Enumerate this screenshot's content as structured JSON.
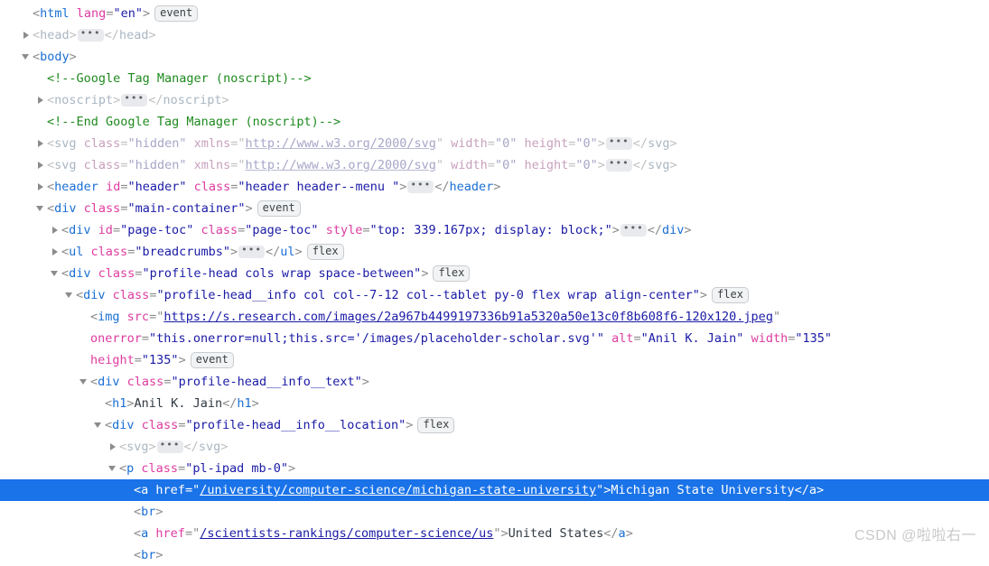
{
  "panel": {
    "name": "devtools-elements-panel",
    "selected_line_index": 19,
    "accent_selection_color": "#1a73e8",
    "tag_color": "#1a6fd4",
    "attr_name_color": "#de3ca0",
    "attr_value_color": "#1a1aa6",
    "comment_color": "#1f8a1f"
  },
  "badges": {
    "event": "event",
    "flex": "flex",
    "ellipsis": "•••"
  },
  "lines": [
    {
      "indent": 1,
      "twisty": "none",
      "dim": false,
      "badge": "event",
      "tokens": [
        {
          "t": "punct",
          "v": "<"
        },
        {
          "t": "tag",
          "v": "html"
        },
        {
          "t": "sp",
          "v": " "
        },
        {
          "t": "attr-name",
          "v": "lang"
        },
        {
          "t": "punct",
          "v": "="
        },
        {
          "t": "attr-val",
          "v": "\"en\""
        },
        {
          "t": "punct",
          "v": ">"
        }
      ]
    },
    {
      "indent": 1,
      "twisty": "closed",
      "dim": true,
      "badge": null,
      "tokens": [
        {
          "t": "punct",
          "v": "<"
        },
        {
          "t": "tag",
          "v": "head"
        },
        {
          "t": "punct",
          "v": ">"
        },
        {
          "t": "ellipsis",
          "v": "•••"
        },
        {
          "t": "punct",
          "v": "</"
        },
        {
          "t": "tag",
          "v": "head"
        },
        {
          "t": "punct",
          "v": ">"
        }
      ]
    },
    {
      "indent": 1,
      "twisty": "open",
      "dim": false,
      "badge": null,
      "tokens": [
        {
          "t": "punct",
          "v": "<"
        },
        {
          "t": "tag",
          "v": "body"
        },
        {
          "t": "punct",
          "v": ">"
        }
      ]
    },
    {
      "indent": 2,
      "twisty": "none",
      "dim": false,
      "badge": null,
      "tokens": [
        {
          "t": "comment",
          "v": "<!--Google Tag Manager (noscript)-->"
        }
      ]
    },
    {
      "indent": 2,
      "twisty": "closed",
      "dim": true,
      "badge": null,
      "tokens": [
        {
          "t": "punct",
          "v": "<"
        },
        {
          "t": "tag",
          "v": "noscript"
        },
        {
          "t": "punct",
          "v": ">"
        },
        {
          "t": "ellipsis",
          "v": "•••"
        },
        {
          "t": "punct",
          "v": "</"
        },
        {
          "t": "tag",
          "v": "noscript"
        },
        {
          "t": "punct",
          "v": ">"
        }
      ]
    },
    {
      "indent": 2,
      "twisty": "none",
      "dim": false,
      "badge": null,
      "tokens": [
        {
          "t": "comment",
          "v": "<!--End Google Tag Manager (noscript)-->"
        }
      ]
    },
    {
      "indent": 2,
      "twisty": "closed",
      "dim": true,
      "badge": null,
      "tokens": [
        {
          "t": "punct",
          "v": "<"
        },
        {
          "t": "tag",
          "v": "svg"
        },
        {
          "t": "sp",
          "v": " "
        },
        {
          "t": "attr-name",
          "v": "class"
        },
        {
          "t": "punct",
          "v": "="
        },
        {
          "t": "attr-val",
          "v": "\"hidden\""
        },
        {
          "t": "sp",
          "v": " "
        },
        {
          "t": "attr-name",
          "v": "xmlns"
        },
        {
          "t": "punct",
          "v": "="
        },
        {
          "t": "punct",
          "v": "\""
        },
        {
          "t": "link",
          "v": "http://www.w3.org/2000/svg"
        },
        {
          "t": "punct",
          "v": "\""
        },
        {
          "t": "sp",
          "v": " "
        },
        {
          "t": "attr-name",
          "v": "width"
        },
        {
          "t": "punct",
          "v": "="
        },
        {
          "t": "attr-val",
          "v": "\"0\""
        },
        {
          "t": "sp",
          "v": " "
        },
        {
          "t": "attr-name",
          "v": "height"
        },
        {
          "t": "punct",
          "v": "="
        },
        {
          "t": "attr-val",
          "v": "\"0\""
        },
        {
          "t": "punct",
          "v": ">"
        },
        {
          "t": "ellipsis",
          "v": "•••"
        },
        {
          "t": "punct",
          "v": "</"
        },
        {
          "t": "tag",
          "v": "svg"
        },
        {
          "t": "punct",
          "v": ">"
        }
      ]
    },
    {
      "indent": 2,
      "twisty": "closed",
      "dim": true,
      "badge": null,
      "tokens": [
        {
          "t": "punct",
          "v": "<"
        },
        {
          "t": "tag",
          "v": "svg"
        },
        {
          "t": "sp",
          "v": " "
        },
        {
          "t": "attr-name",
          "v": "class"
        },
        {
          "t": "punct",
          "v": "="
        },
        {
          "t": "attr-val",
          "v": "\"hidden\""
        },
        {
          "t": "sp",
          "v": " "
        },
        {
          "t": "attr-name",
          "v": "xmlns"
        },
        {
          "t": "punct",
          "v": "="
        },
        {
          "t": "punct",
          "v": "\""
        },
        {
          "t": "link",
          "v": "http://www.w3.org/2000/svg"
        },
        {
          "t": "punct",
          "v": "\""
        },
        {
          "t": "sp",
          "v": " "
        },
        {
          "t": "attr-name",
          "v": "width"
        },
        {
          "t": "punct",
          "v": "="
        },
        {
          "t": "attr-val",
          "v": "\"0\""
        },
        {
          "t": "sp",
          "v": " "
        },
        {
          "t": "attr-name",
          "v": "height"
        },
        {
          "t": "punct",
          "v": "="
        },
        {
          "t": "attr-val",
          "v": "\"0\""
        },
        {
          "t": "punct",
          "v": ">"
        },
        {
          "t": "ellipsis",
          "v": "•••"
        },
        {
          "t": "punct",
          "v": "</"
        },
        {
          "t": "tag",
          "v": "svg"
        },
        {
          "t": "punct",
          "v": ">"
        }
      ]
    },
    {
      "indent": 2,
      "twisty": "closed",
      "dim": false,
      "badge": null,
      "tokens": [
        {
          "t": "punct",
          "v": "<"
        },
        {
          "t": "tag",
          "v": "header"
        },
        {
          "t": "sp",
          "v": " "
        },
        {
          "t": "attr-name",
          "v": "id"
        },
        {
          "t": "punct",
          "v": "="
        },
        {
          "t": "attr-val",
          "v": "\"header\""
        },
        {
          "t": "sp",
          "v": " "
        },
        {
          "t": "attr-name",
          "v": "class"
        },
        {
          "t": "punct",
          "v": "="
        },
        {
          "t": "attr-val",
          "v": "\"header header--menu \""
        },
        {
          "t": "punct",
          "v": ">"
        },
        {
          "t": "ellipsis",
          "v": "•••"
        },
        {
          "t": "punct",
          "v": "</"
        },
        {
          "t": "tag",
          "v": "header"
        },
        {
          "t": "punct",
          "v": ">"
        }
      ]
    },
    {
      "indent": 2,
      "twisty": "open",
      "dim": false,
      "badge": "event",
      "tokens": [
        {
          "t": "punct",
          "v": "<"
        },
        {
          "t": "tag",
          "v": "div"
        },
        {
          "t": "sp",
          "v": " "
        },
        {
          "t": "attr-name",
          "v": "class"
        },
        {
          "t": "punct",
          "v": "="
        },
        {
          "t": "attr-val",
          "v": "\"main-container\""
        },
        {
          "t": "punct",
          "v": ">"
        }
      ]
    },
    {
      "indent": 3,
      "twisty": "closed",
      "dim": false,
      "badge": null,
      "tokens": [
        {
          "t": "punct",
          "v": "<"
        },
        {
          "t": "tag",
          "v": "div"
        },
        {
          "t": "sp",
          "v": " "
        },
        {
          "t": "attr-name",
          "v": "id"
        },
        {
          "t": "punct",
          "v": "="
        },
        {
          "t": "attr-val",
          "v": "\"page-toc\""
        },
        {
          "t": "sp",
          "v": " "
        },
        {
          "t": "attr-name",
          "v": "class"
        },
        {
          "t": "punct",
          "v": "="
        },
        {
          "t": "attr-val",
          "v": "\"page-toc\""
        },
        {
          "t": "sp",
          "v": " "
        },
        {
          "t": "attr-name",
          "v": "style"
        },
        {
          "t": "punct",
          "v": "="
        },
        {
          "t": "attr-val",
          "v": "\"top: 339.167px; display: block;\""
        },
        {
          "t": "punct",
          "v": ">"
        },
        {
          "t": "ellipsis",
          "v": "•••"
        },
        {
          "t": "punct",
          "v": "</"
        },
        {
          "t": "tag",
          "v": "div"
        },
        {
          "t": "punct",
          "v": ">"
        }
      ]
    },
    {
      "indent": 3,
      "twisty": "closed",
      "dim": false,
      "badge": "flex",
      "tokens": [
        {
          "t": "punct",
          "v": "<"
        },
        {
          "t": "tag",
          "v": "ul"
        },
        {
          "t": "sp",
          "v": " "
        },
        {
          "t": "attr-name",
          "v": "class"
        },
        {
          "t": "punct",
          "v": "="
        },
        {
          "t": "attr-val",
          "v": "\"breadcrumbs\""
        },
        {
          "t": "punct",
          "v": ">"
        },
        {
          "t": "ellipsis",
          "v": "•••"
        },
        {
          "t": "punct",
          "v": "</"
        },
        {
          "t": "tag",
          "v": "ul"
        },
        {
          "t": "punct",
          "v": ">"
        }
      ]
    },
    {
      "indent": 3,
      "twisty": "open",
      "dim": false,
      "badge": "flex",
      "tokens": [
        {
          "t": "punct",
          "v": "<"
        },
        {
          "t": "tag",
          "v": "div"
        },
        {
          "t": "sp",
          "v": " "
        },
        {
          "t": "attr-name",
          "v": "class"
        },
        {
          "t": "punct",
          "v": "="
        },
        {
          "t": "attr-val",
          "v": "\"profile-head cols wrap space-between\""
        },
        {
          "t": "punct",
          "v": ">"
        }
      ]
    },
    {
      "indent": 4,
      "twisty": "open",
      "dim": false,
      "badge": "flex",
      "tokens": [
        {
          "t": "punct",
          "v": "<"
        },
        {
          "t": "tag",
          "v": "div"
        },
        {
          "t": "sp",
          "v": " "
        },
        {
          "t": "attr-name",
          "v": "class"
        },
        {
          "t": "punct",
          "v": "="
        },
        {
          "t": "attr-val",
          "v": "\"profile-head__info col col--7-12 col--tablet py-0 flex wrap align-center\""
        },
        {
          "t": "punct",
          "v": ">"
        }
      ]
    },
    {
      "indent": 5,
      "twisty": "none",
      "dim": false,
      "badge": null,
      "tokens": [
        {
          "t": "punct",
          "v": "<"
        },
        {
          "t": "tag",
          "v": "img"
        },
        {
          "t": "sp",
          "v": " "
        },
        {
          "t": "attr-name",
          "v": "src"
        },
        {
          "t": "punct",
          "v": "="
        },
        {
          "t": "punct",
          "v": "\""
        },
        {
          "t": "link",
          "v": "https://s.research.com/images/2a967b4499197336b91a5320a50e13c0f8b608f6-120x120.jpeg"
        },
        {
          "t": "punct",
          "v": "\""
        }
      ]
    },
    {
      "indent": 5,
      "twisty": "none",
      "dim": false,
      "badge": null,
      "continuation": true,
      "tokens": [
        {
          "t": "attr-name",
          "v": "onerror"
        },
        {
          "t": "punct",
          "v": "="
        },
        {
          "t": "attr-val",
          "v": "\"this.onerror=null;this.src='/images/placeholder-scholar.svg'\""
        },
        {
          "t": "sp",
          "v": " "
        },
        {
          "t": "attr-name",
          "v": "alt"
        },
        {
          "t": "punct",
          "v": "="
        },
        {
          "t": "attr-val",
          "v": "\"Anil K. Jain\""
        },
        {
          "t": "sp",
          "v": " "
        },
        {
          "t": "attr-name",
          "v": "width"
        },
        {
          "t": "punct",
          "v": "="
        },
        {
          "t": "attr-val",
          "v": "\"135\""
        }
      ]
    },
    {
      "indent": 5,
      "twisty": "none",
      "dim": false,
      "badge": "event",
      "continuation": true,
      "tokens": [
        {
          "t": "attr-name",
          "v": "height"
        },
        {
          "t": "punct",
          "v": "="
        },
        {
          "t": "attr-val",
          "v": "\"135\""
        },
        {
          "t": "punct",
          "v": ">"
        }
      ]
    },
    {
      "indent": 5,
      "twisty": "open",
      "dim": false,
      "badge": null,
      "tokens": [
        {
          "t": "punct",
          "v": "<"
        },
        {
          "t": "tag",
          "v": "div"
        },
        {
          "t": "sp",
          "v": " "
        },
        {
          "t": "attr-name",
          "v": "class"
        },
        {
          "t": "punct",
          "v": "="
        },
        {
          "t": "attr-val",
          "v": "\"profile-head__info__text\""
        },
        {
          "t": "punct",
          "v": ">"
        }
      ]
    },
    {
      "indent": 6,
      "twisty": "none",
      "dim": false,
      "badge": null,
      "tokens": [
        {
          "t": "punct",
          "v": "<"
        },
        {
          "t": "tag",
          "v": "h1"
        },
        {
          "t": "punct",
          "v": ">"
        },
        {
          "t": "text",
          "v": "Anil K. Jain"
        },
        {
          "t": "punct",
          "v": "</"
        },
        {
          "t": "tag",
          "v": "h1"
        },
        {
          "t": "punct",
          "v": ">"
        }
      ]
    },
    {
      "indent": 6,
      "twisty": "open",
      "dim": false,
      "badge": "flex",
      "tokens": [
        {
          "t": "punct",
          "v": "<"
        },
        {
          "t": "tag",
          "v": "div"
        },
        {
          "t": "sp",
          "v": " "
        },
        {
          "t": "attr-name",
          "v": "class"
        },
        {
          "t": "punct",
          "v": "="
        },
        {
          "t": "attr-val",
          "v": "\"profile-head__info__location\""
        },
        {
          "t": "punct",
          "v": ">"
        }
      ]
    },
    {
      "indent": 7,
      "twisty": "closed",
      "dim": true,
      "badge": null,
      "tokens": [
        {
          "t": "punct",
          "v": "<"
        },
        {
          "t": "tag",
          "v": "svg"
        },
        {
          "t": "punct",
          "v": ">"
        },
        {
          "t": "ellipsis",
          "v": "•••"
        },
        {
          "t": "punct",
          "v": "</"
        },
        {
          "t": "tag",
          "v": "svg"
        },
        {
          "t": "punct",
          "v": ">"
        }
      ]
    },
    {
      "indent": 7,
      "twisty": "open",
      "dim": false,
      "badge": null,
      "tokens": [
        {
          "t": "punct",
          "v": "<"
        },
        {
          "t": "tag",
          "v": "p"
        },
        {
          "t": "sp",
          "v": " "
        },
        {
          "t": "attr-name",
          "v": "class"
        },
        {
          "t": "punct",
          "v": "="
        },
        {
          "t": "attr-val",
          "v": "\"pl-ipad mb-0\""
        },
        {
          "t": "punct",
          "v": ">"
        }
      ]
    },
    {
      "indent": 8,
      "twisty": "none",
      "dim": false,
      "selected": true,
      "badge": null,
      "tokens": [
        {
          "t": "punct",
          "v": "<"
        },
        {
          "t": "tag",
          "v": "a"
        },
        {
          "t": "sp",
          "v": " "
        },
        {
          "t": "attr-name",
          "v": "href"
        },
        {
          "t": "punct",
          "v": "="
        },
        {
          "t": "punct",
          "v": "\""
        },
        {
          "t": "link",
          "v": "/university/computer-science/michigan-state-university"
        },
        {
          "t": "punct",
          "v": "\""
        },
        {
          "t": "punct",
          "v": ">"
        },
        {
          "t": "text",
          "v": "Michigan State University"
        },
        {
          "t": "punct",
          "v": "</"
        },
        {
          "t": "tag",
          "v": "a"
        },
        {
          "t": "punct",
          "v": ">"
        }
      ]
    },
    {
      "indent": 8,
      "twisty": "none",
      "dim": false,
      "badge": null,
      "tokens": [
        {
          "t": "punct",
          "v": "<"
        },
        {
          "t": "tag",
          "v": "br"
        },
        {
          "t": "punct",
          "v": ">"
        }
      ]
    },
    {
      "indent": 8,
      "twisty": "none",
      "dim": false,
      "badge": null,
      "tokens": [
        {
          "t": "punct",
          "v": "<"
        },
        {
          "t": "tag",
          "v": "a"
        },
        {
          "t": "sp",
          "v": " "
        },
        {
          "t": "attr-name",
          "v": "href"
        },
        {
          "t": "punct",
          "v": "="
        },
        {
          "t": "punct",
          "v": "\""
        },
        {
          "t": "link",
          "v": "/scientists-rankings/computer-science/us"
        },
        {
          "t": "punct",
          "v": "\""
        },
        {
          "t": "punct",
          "v": ">"
        },
        {
          "t": "text",
          "v": "United States"
        },
        {
          "t": "punct",
          "v": "</"
        },
        {
          "t": "tag",
          "v": "a"
        },
        {
          "t": "punct",
          "v": ">"
        }
      ]
    },
    {
      "indent": 8,
      "twisty": "none",
      "dim": false,
      "badge": null,
      "tokens": [
        {
          "t": "punct",
          "v": "<"
        },
        {
          "t": "tag",
          "v": "br"
        },
        {
          "t": "punct",
          "v": ">"
        }
      ]
    }
  ],
  "watermark": "CSDN @啦啦右一"
}
